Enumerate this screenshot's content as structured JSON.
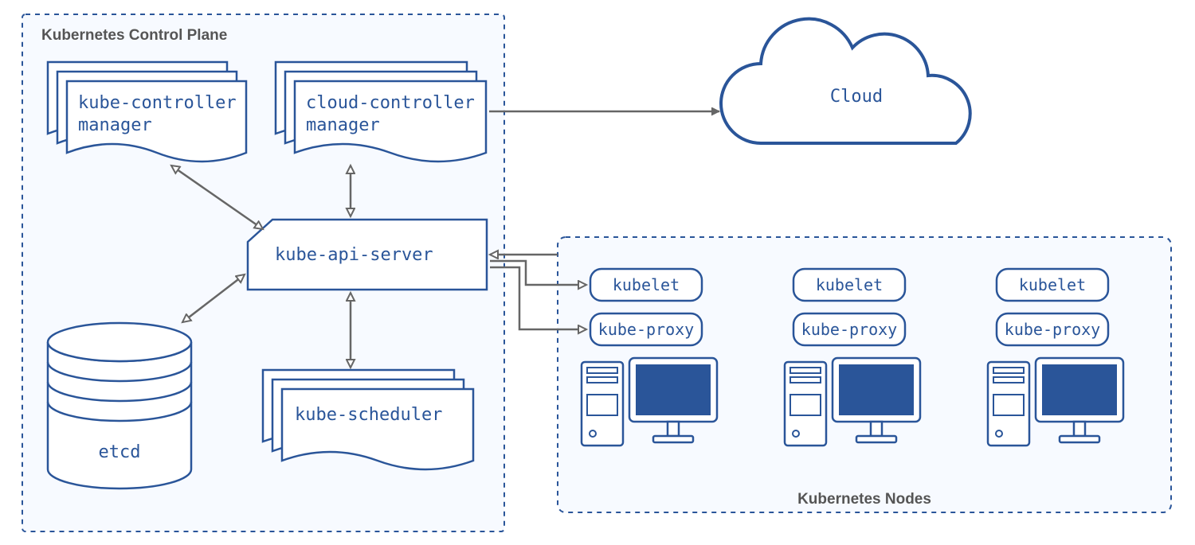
{
  "control_plane": {
    "title": "Kubernetes Control Plane",
    "components": {
      "kube_controller_manager_l1": "kube-controller",
      "kube_controller_manager_l2": "manager",
      "cloud_controller_manager_l1": "cloud-controller",
      "cloud_controller_manager_l2": "manager",
      "kube_api_server": "kube-api-server",
      "kube_scheduler": "kube-scheduler",
      "etcd": "etcd"
    }
  },
  "nodes": {
    "title": "Kubernetes Nodes",
    "node_components": {
      "kubelet": "kubelet",
      "kube_proxy": "kube-proxy"
    }
  },
  "cloud": {
    "label": "Cloud"
  }
}
